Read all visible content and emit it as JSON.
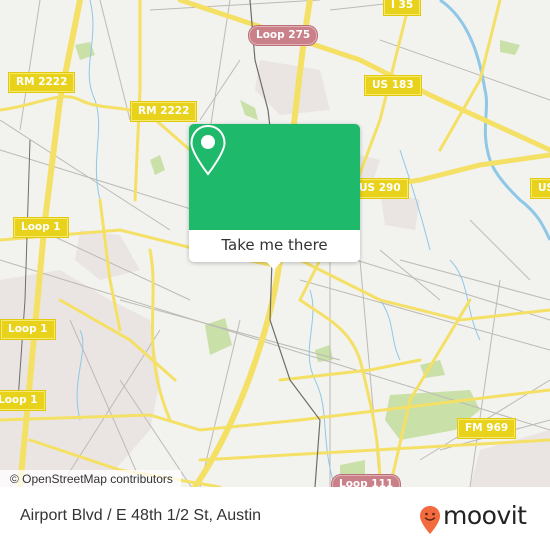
{
  "map": {
    "attribution": "© OpenStreetMap contributors",
    "road_labels": [
      {
        "id": "rm2222-west",
        "text": "RM 2222",
        "style": "state"
      },
      {
        "id": "rm2222-east",
        "text": "RM 2222",
        "style": "state"
      },
      {
        "id": "loop275",
        "text": "Loop 275",
        "style": "loop"
      },
      {
        "id": "i35",
        "text": "I 35",
        "style": "state"
      },
      {
        "id": "us183",
        "text": "US 183",
        "style": "state"
      },
      {
        "id": "us290",
        "text": "US 290",
        "style": "state"
      },
      {
        "id": "us-east",
        "text": "US",
        "style": "state"
      },
      {
        "id": "loop1-a",
        "text": "Loop 1",
        "style": "state"
      },
      {
        "id": "loop1-b",
        "text": "Loop 1",
        "style": "state"
      },
      {
        "id": "loop1-c",
        "text": "Loop 1",
        "style": "state"
      },
      {
        "id": "fm969",
        "text": "FM 969",
        "style": "state"
      },
      {
        "id": "loop111",
        "text": "Loop 111",
        "style": "loop"
      }
    ],
    "colors": {
      "background": "#f2f2ef",
      "major_road": "#f5e066",
      "minor_road": "#b9b6b0",
      "water": "#8fc8e6",
      "park": "#c9e0a8",
      "urban": "#e9e3e1",
      "rail": "#6d6d6d"
    }
  },
  "popup": {
    "icon": "location-pin-icon",
    "button_label": "Take me there",
    "accent_color": "#1fb96b"
  },
  "footer": {
    "location_title": "Airport Blvd / E 48th 1/2 St, Austin",
    "brand": {
      "name": "moovit",
      "icon": "moovit-smiley-pin-icon",
      "color": "#f26a3d"
    }
  }
}
